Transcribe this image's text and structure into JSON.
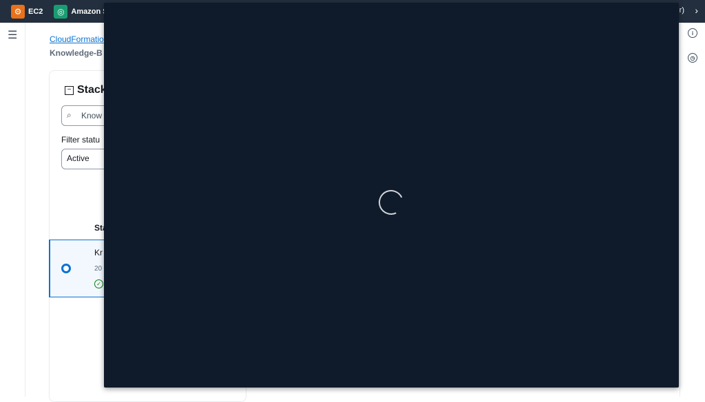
{
  "topbar": {
    "favorites": [
      {
        "label": "EC2",
        "icon": "ec2-icon"
      },
      {
        "label": "Amazon S",
        "icon": "sagemaker-icon"
      }
    ],
    "right_text": "r)",
    "chevron": "›"
  },
  "left_rail": {
    "menu_icon": "☰"
  },
  "right_rail": {
    "info_icon": "i",
    "history_icon": "◷"
  },
  "breadcrumb": {
    "link": "CloudFormatio",
    "current": "Knowledge-B"
  },
  "panel": {
    "collapse_symbol": "−",
    "title": "Stack",
    "search": {
      "icon": "⌕",
      "value": "Know"
    },
    "filter": {
      "label": "Filter statu",
      "value": "Active"
    },
    "table": {
      "column_header": "Sta",
      "rows": [
        {
          "name": "Kr",
          "date": "20",
          "status_icon": "✓",
          "selected": true
        }
      ]
    }
  },
  "modal": {
    "state": "loading"
  },
  "colors": {
    "topbar": "#232f3e",
    "modal": "#0f1b2a",
    "accent": "#0972d3",
    "success": "#037f0c"
  }
}
